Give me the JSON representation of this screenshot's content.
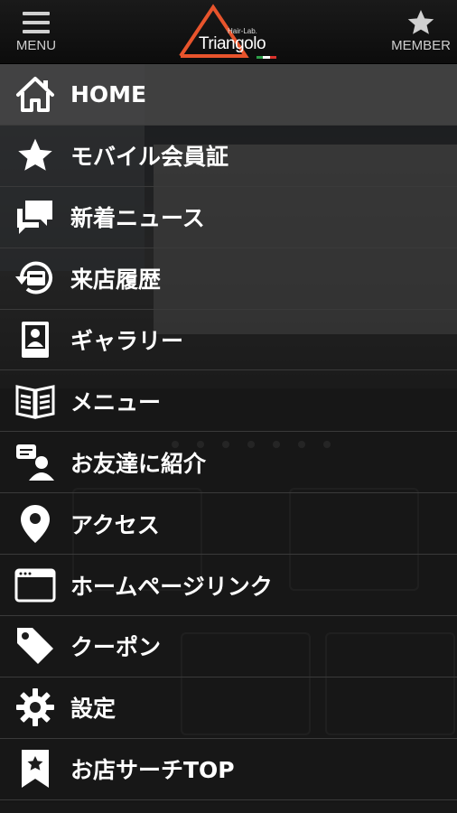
{
  "header": {
    "menu_label": "MENU",
    "member_label": "MEMBER",
    "logo_sub": "Hair-Lab.",
    "logo_name": "Triangolo",
    "accent": "#e8542c"
  },
  "menu": {
    "items": [
      {
        "label": "HOME",
        "icon": "home-icon"
      },
      {
        "label": "モバイル会員証",
        "icon": "star-icon"
      },
      {
        "label": "新着ニュース",
        "icon": "chat-bubbles-icon"
      },
      {
        "label": "来店履歴",
        "icon": "history-icon"
      },
      {
        "label": "ギャラリー",
        "icon": "portrait-icon"
      },
      {
        "label": "メニュー",
        "icon": "book-icon"
      },
      {
        "label": "お友達に紹介",
        "icon": "refer-friend-icon"
      },
      {
        "label": "アクセス",
        "icon": "map-pin-icon"
      },
      {
        "label": "ホームページリンク",
        "icon": "browser-window-icon"
      },
      {
        "label": "クーポン",
        "icon": "tag-icon"
      },
      {
        "label": "設定",
        "icon": "gear-icon"
      },
      {
        "label": "お店サーチTOP",
        "icon": "bookmark-star-icon"
      }
    ],
    "active_index": 0
  }
}
